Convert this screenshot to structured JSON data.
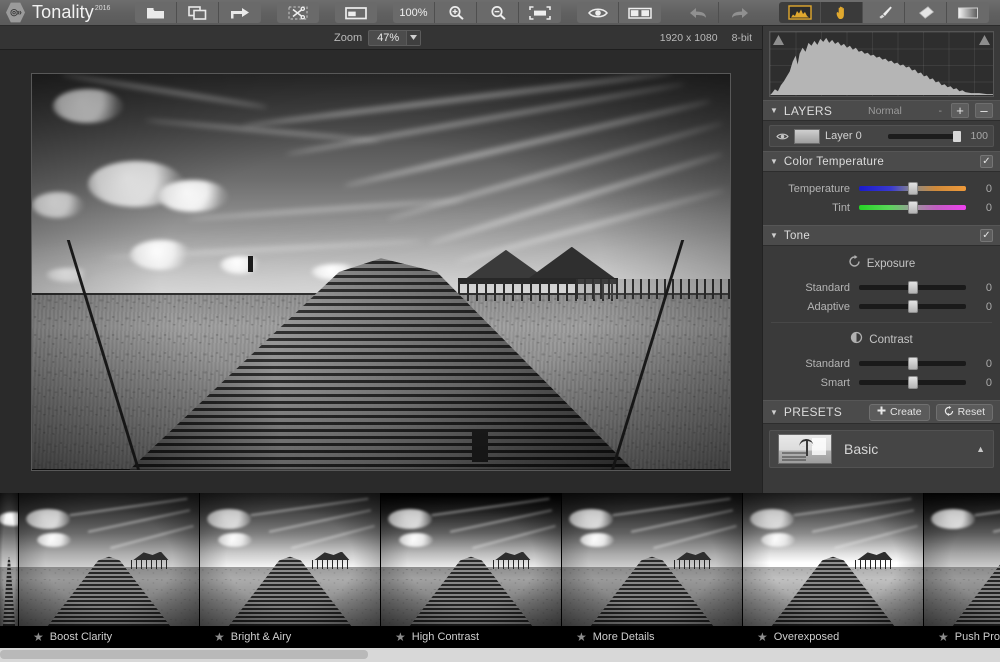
{
  "app": {
    "name": "Tonality",
    "version": "2016",
    "logo_icon": "hexagon-logo-icon"
  },
  "toolbar": {
    "groups": [
      {
        "name": "file-group",
        "buttons": [
          {
            "name": "open-image-button",
            "icon": "folder-open-icon",
            "label": ""
          },
          {
            "name": "duplicate-layers-button",
            "icon": "copy-layers-icon",
            "label": ""
          },
          {
            "name": "share-export-button",
            "icon": "share-arrow-icon",
            "label": ""
          }
        ]
      },
      {
        "name": "crop-group",
        "buttons": [
          {
            "name": "crop-button",
            "icon": "crop-scissors-icon",
            "label": ""
          }
        ]
      },
      {
        "name": "compare-group",
        "buttons": [
          {
            "name": "compare-panel-button",
            "icon": "panel-window-icon",
            "label": ""
          }
        ]
      },
      {
        "name": "zoom-group",
        "buttons": [
          {
            "name": "zoom-100-button",
            "icon": "zoom-100-text-icon",
            "label": "100%"
          },
          {
            "name": "zoom-in-button",
            "icon": "magnifier-plus-icon",
            "label": ""
          },
          {
            "name": "zoom-out-button",
            "icon": "magnifier-minus-icon",
            "label": ""
          },
          {
            "name": "fit-to-screen-button",
            "icon": "fit-screen-icon",
            "label": ""
          }
        ]
      },
      {
        "name": "preview-group",
        "buttons": [
          {
            "name": "quick-preview-button",
            "icon": "eye-icon",
            "label": ""
          },
          {
            "name": "before-after-button",
            "icon": "split-view-icon",
            "label": ""
          }
        ]
      },
      {
        "name": "history-group",
        "buttons": [
          {
            "name": "undo-button",
            "icon": "undo-arrow-icon",
            "label": ""
          },
          {
            "name": "redo-button",
            "icon": "redo-arrow-icon",
            "label": ""
          }
        ]
      },
      {
        "name": "tools-group",
        "buttons": [
          {
            "name": "histogram-toggle-button",
            "icon": "histogram-icon",
            "label": "",
            "active": true
          },
          {
            "name": "hand-tool-button",
            "icon": "hand-icon",
            "label": "",
            "active": true
          },
          {
            "name": "brush-tool-button",
            "icon": "brush-icon",
            "label": ""
          },
          {
            "name": "eraser-tool-button",
            "icon": "eraser-icon",
            "label": ""
          },
          {
            "name": "gradient-tool-button",
            "icon": "gradient-mask-icon",
            "label": ""
          }
        ]
      }
    ],
    "accent_color": "#e0a82e"
  },
  "subbar": {
    "zoom_label": "Zoom",
    "zoom_value": "47%",
    "zoom_caret": "▼",
    "image_dimensions": "1920 x 1080",
    "bit_depth": "8-bit"
  },
  "canvas": {
    "image_alt": "Black and white photo of a curving wooden boardwalk leading to an overwater pier house under dramatic cirrus clouds"
  },
  "histogram": {
    "title": "histogram",
    "clip_left_icon": "clipping-triangle-icon",
    "clip_right_icon": "clipping-triangle-icon"
  },
  "layers": {
    "caret": "▼",
    "title": "LAYERS",
    "blend_mode": "Normal",
    "blend_caret": "-",
    "add_label": "+",
    "remove_label": "–",
    "rows": [
      {
        "visibility_icon": "eye-icon",
        "name": "Layer 0",
        "opacity": "100"
      }
    ]
  },
  "color_temperature": {
    "caret": "▼",
    "title": "Color Temperature",
    "enabled_check": "✓",
    "sliders": [
      {
        "label": "Temperature",
        "value": "0",
        "gradient": "blue-to-orange"
      },
      {
        "label": "Tint",
        "value": "0",
        "gradient": "green-to-magenta"
      }
    ]
  },
  "tone": {
    "caret": "▼",
    "title": "Tone",
    "enabled_check": "✓",
    "groups": [
      {
        "name": "Exposure",
        "icon": "exposure-reset-icon",
        "sliders": [
          {
            "label": "Standard",
            "value": "0"
          },
          {
            "label": "Adaptive",
            "value": "0"
          }
        ]
      },
      {
        "name": "Contrast",
        "icon": "contrast-half-circle-icon",
        "sliders": [
          {
            "label": "Standard",
            "value": "0"
          },
          {
            "label": "Smart",
            "value": "0"
          }
        ]
      }
    ]
  },
  "presets": {
    "caret": "▼",
    "title": "PRESETS",
    "create_label": "Create",
    "create_icon": "plus-icon",
    "reset_label": "Reset",
    "reset_icon": "refresh-icon",
    "categories": [
      {
        "name": "Basic",
        "expand_caret": "▲",
        "thumb": "basic-preset-thumbnail"
      }
    ]
  },
  "filmstrip": {
    "items": [
      {
        "name": "Boost Clarity",
        "favorite_icon": "star-icon"
      },
      {
        "name": "Bright & Airy",
        "favorite_icon": "star-icon"
      },
      {
        "name": "High Contrast",
        "favorite_icon": "star-icon"
      },
      {
        "name": "More Details",
        "favorite_icon": "star-icon"
      },
      {
        "name": "Overexposed",
        "favorite_icon": "star-icon"
      },
      {
        "name": "Push Proce",
        "favorite_icon": "star-icon"
      }
    ]
  }
}
